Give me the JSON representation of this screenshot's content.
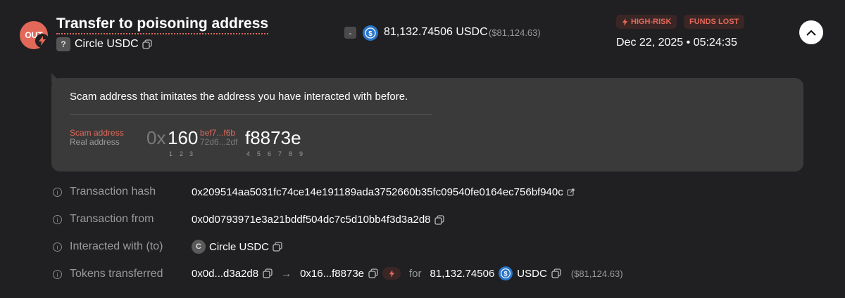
{
  "header": {
    "direction_badge": "OUT",
    "title": "Transfer to poisoning address",
    "unknown_badge": "?",
    "token_name": "Circle USDC",
    "minus_badge": "-",
    "amount": "81,132.74506 USDC",
    "amount_usd": "($81,124.63)",
    "risk_badge": "HIGH-RISK",
    "lost_badge": "FUNDS LOST",
    "datetime": "Dec 22, 2025 • 05:24:35"
  },
  "panel": {
    "message": "Scam address that imitates the address you have interacted with before.",
    "scam_label": "Scam address",
    "real_label": "Real address",
    "prefix": "0x",
    "match_head": "160",
    "scam_middle": "bef7...f6b",
    "real_middle": "72d6...2df",
    "match_tail": "f8873e",
    "head_indices": [
      "1",
      "2",
      "3"
    ],
    "tail_indices": [
      "4",
      "5",
      "6",
      "7",
      "8",
      "9"
    ]
  },
  "details": [
    {
      "label": "Transaction hash",
      "value": "0x209514aa5031fc74ce14e191189ada3752660b35fc09540fe0164ec756bf940c"
    },
    {
      "label": "Transaction from",
      "value": "0x0d0793971e3a21bddf504dc7c5d10bb4f3d3a2d8"
    },
    {
      "label": "Interacted with (to)",
      "value": "Circle USDC",
      "badge": "C"
    },
    {
      "label": "Tokens transferred",
      "from": "0x0d...d3a2d8",
      "arrow": "→",
      "to": "0x16...f8873e",
      "for_word": "for",
      "amount": "81,132.74506",
      "symbol": "USDC",
      "usd": "($81,124.63)"
    }
  ],
  "colors": {
    "background": "#202022",
    "panel": "#3a3a3a",
    "danger": "#e2685a",
    "usdc": "#2775ca"
  }
}
